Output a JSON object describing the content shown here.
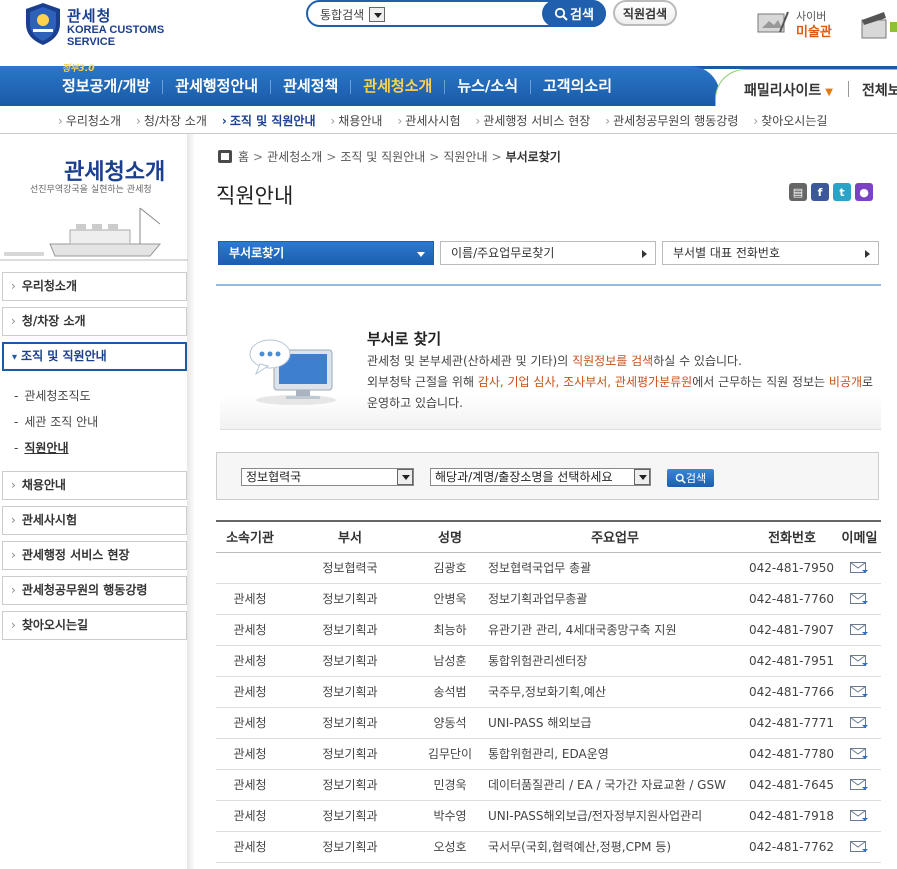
{
  "header": {
    "logo_ko": "관세청",
    "logo_en_1": "KOREA CUSTOMS",
    "logo_en_2": "SERVICE",
    "search_scope": "통합검색",
    "search_button": "검색",
    "staff_search_button": "직원검색",
    "cyber_1": "사이버",
    "cyber_2": "미술관"
  },
  "gnb": {
    "gov30": "정부3.0",
    "items": [
      "정보공개/개방",
      "관세행정안내",
      "관세정책",
      "관세청소개",
      "뉴스/소식",
      "고객의소리"
    ],
    "family": "패밀리사이트",
    "total": "전체보"
  },
  "subnav": [
    "우리청소개",
    "청/차장 소개",
    "조직 및 직원안내",
    "채용안내",
    "관세사시험",
    "관세행정 서비스 현장",
    "관세청공무원의 행동강령",
    "찾아오시는길"
  ],
  "lnb": {
    "title": "관세청소개",
    "subtitle": "선진무역강국을 실현하는 관세청",
    "items": [
      "우리청소개",
      "청/차장 소개",
      "조직 및 직원안내",
      "채용안내",
      "관세사시험",
      "관세행정 서비스 현장",
      "관세청공무원의 행동강령",
      "찾아오시는길"
    ],
    "subitems": [
      "관세청조직도",
      "세관 조직 안내",
      "직원안내"
    ]
  },
  "breadcrumb": [
    "홈",
    "관세청소개",
    "조직 및 직원안내",
    "직원안내",
    "부서로찾기"
  ],
  "page_title": "직원안내",
  "tabs": [
    "부서로찾기",
    "이름/주요업무로찾기",
    "부서별 대표 전화번호"
  ],
  "intro": {
    "title": "부서로 찾기",
    "l1a": "관세청 및 본부세관(산하세관 및 기타)의 ",
    "l1b": "직원정보를 검색",
    "l1c": "하실 수 있습니다.",
    "l2a": "외부청탁 근절을 위해 ",
    "l2b": "감사, 기업 심사, 조사부서, 관세평가분류원",
    "l2c": "에서 근무하는 직원 정보는 ",
    "l2d": "비공개",
    "l2e": "로 운영하고 있습니다."
  },
  "filter": {
    "dept_select": "정보협력국",
    "sub_select": "해당과/계명/출장소명을 선택하세요",
    "button": "검색"
  },
  "table": {
    "headers": [
      "소속기관",
      "부서",
      "성명",
      "주요업무",
      "전화번호",
      "이메일"
    ],
    "rows": [
      [
        "",
        "정보협력국",
        "김광호",
        "정보협력국업무 총괄",
        "042-481-7950"
      ],
      [
        "관세청",
        "정보기획과",
        "안병욱",
        "정보기획과업무총괄",
        "042-481-7760"
      ],
      [
        "관세청",
        "정보기획과",
        "최능하",
        "유관기관 관리, 4세대국종망구축 지원",
        "042-481-7907"
      ],
      [
        "관세청",
        "정보기획과",
        "남성훈",
        "통합위험관리센터장",
        "042-481-7951"
      ],
      [
        "관세청",
        "정보기획과",
        "송석범",
        "국주무,정보화기획,예산",
        "042-481-7766"
      ],
      [
        "관세청",
        "정보기획과",
        "양동석",
        "UNI-PASS 해외보급",
        "042-481-7771"
      ],
      [
        "관세청",
        "정보기획과",
        "김무단이",
        "통합위험관리, EDA운영",
        "042-481-7780"
      ],
      [
        "관세청",
        "정보기획과",
        "민경욱",
        "데이터품질관리 / EA / 국가간 자료교환 / GSW",
        "042-481-7645"
      ],
      [
        "관세청",
        "정보기획과",
        "박수영",
        "UNI-PASS해외보급/전자정부지원사업관리",
        "042-481-7918"
      ],
      [
        "관세청",
        "정보기획과",
        "오성호",
        "국서무(국회,협력예산,정평,CPM 등)",
        "042-481-7762"
      ]
    ]
  }
}
